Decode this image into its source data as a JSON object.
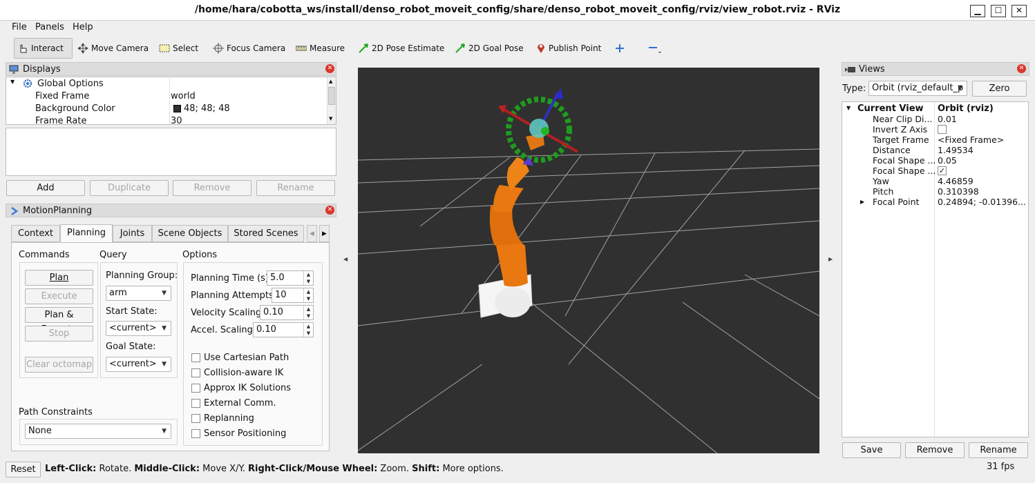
{
  "window": {
    "title": "/home/hara/cobotta_ws/install/denso_robot_moveit_config/share/denso_robot_moveit_config/rviz/view_robot.rviz - RViz",
    "minimize": "▁",
    "maximize": "☐",
    "close": "✕"
  },
  "menu": [
    "File",
    "Panels",
    "Help"
  ],
  "toolbar": {
    "interact": "Interact",
    "move_camera": "Move Camera",
    "select": "Select",
    "focus_camera": "Focus Camera",
    "measure": "Measure",
    "pose_estimate": "2D Pose Estimate",
    "goal_pose": "2D Goal Pose",
    "publish_point": "Publish Point"
  },
  "displays": {
    "title": "Displays",
    "global_options": "Global Options",
    "rows": [
      {
        "key": "Fixed Frame",
        "value": "world"
      },
      {
        "key": "Background Color",
        "value": "48; 48; 48"
      },
      {
        "key": "Frame Rate",
        "value": "30"
      }
    ],
    "swatch_color": "#303030",
    "buttons": {
      "add": "Add",
      "duplicate": "Duplicate",
      "remove": "Remove",
      "rename": "Rename"
    }
  },
  "motion": {
    "title": "MotionPlanning",
    "tabs": [
      "Context",
      "Planning",
      "Joints",
      "Scene Objects",
      "Stored Scenes"
    ],
    "commands": {
      "label": "Commands",
      "plan": "Plan",
      "execute": "Execute",
      "plan_execute": "Plan & Execute",
      "stop": "Stop",
      "clear": "Clear octomap"
    },
    "query": {
      "label": "Query",
      "group_label": "Planning Group:",
      "group": "arm",
      "start_label": "Start State:",
      "start": "<current>",
      "goal_label": "Goal State:",
      "goal": "<current>"
    },
    "options": {
      "label": "Options",
      "planning_time_label": "Planning Time (s):",
      "planning_time": "5.0",
      "attempts_label": "Planning Attempts:",
      "attempts": "10",
      "velocity_label": "Velocity Scaling:",
      "velocity": "0.10",
      "accel_label": "Accel. Scaling:",
      "accel": "0.10",
      "checks": [
        "Use Cartesian Path",
        "Collision-aware IK",
        "Approx IK Solutions",
        "External Comm.",
        "Replanning",
        "Sensor Positioning"
      ]
    },
    "path_constraints_label": "Path Constraints",
    "path_constraints": "None"
  },
  "views": {
    "title": "Views",
    "type_label": "Type:",
    "type_value": "Orbit (rviz_default_p",
    "zero": "Zero",
    "current_view": "Current View",
    "current_view_type": "Orbit (rviz)",
    "rows": [
      {
        "key": "Near Clip Di...",
        "value": "0.01"
      },
      {
        "key": "Invert Z Axis",
        "value": ""
      },
      {
        "key": "Target Frame",
        "value": "<Fixed Frame>"
      },
      {
        "key": "Distance",
        "value": "1.49534"
      },
      {
        "key": "Focal Shape ...",
        "value": "0.05"
      },
      {
        "key": "Focal Shape ...",
        "value": "✓"
      },
      {
        "key": "Yaw",
        "value": "4.46859"
      },
      {
        "key": "Pitch",
        "value": "0.310398"
      },
      {
        "key": "Focal Point",
        "value": "0.24894; -0.01396..."
      }
    ],
    "buttons": {
      "save": "Save",
      "remove": "Remove",
      "rename": "Rename"
    }
  },
  "status": {
    "reset": "Reset",
    "left_click": "Left-Click:",
    "left_desc": " Rotate. ",
    "middle_click": "Middle-Click:",
    "middle_desc": " Move X/Y. ",
    "right_click": "Right-Click/Mouse Wheel:",
    "right_desc": " Zoom. ",
    "shift": "Shift:",
    "shift_desc": " More options.",
    "fps": "31 fps"
  },
  "colors": {
    "viewport_bg": "#303030",
    "robot": "#e8780f",
    "grid": "#a0a0a0",
    "ring": "#1fa01f"
  }
}
